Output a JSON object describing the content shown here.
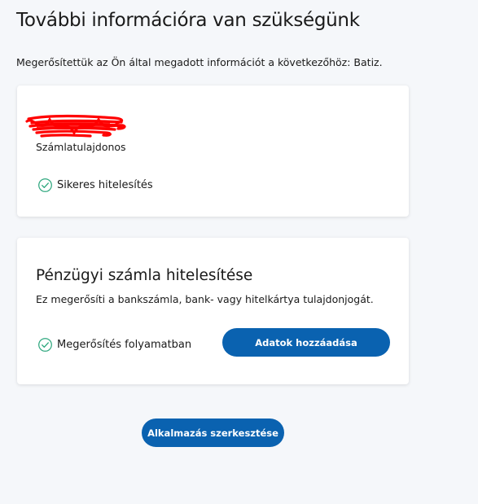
{
  "header": {
    "title": "További információra van szükségünk",
    "intro": "Megerősítettük az Ön által megadott információt a következőhöz: Batiz."
  },
  "account_card": {
    "role": "Számlatulajdonos",
    "status": "Sikeres hitelesítés",
    "status_icon": "check-circle-icon"
  },
  "verification_card": {
    "title": "Pénzügyi számla hitelesítése",
    "description": "Ez megerősíti a bankszámla, bank- vagy hitelkártya tulajdonjogát.",
    "status": "Megerősítés folyamatban",
    "status_icon": "check-circle-icon",
    "add_button_label": "Adatok hozzáadása"
  },
  "footer": {
    "edit_button_label": "Alkalmazás szerkesztése"
  },
  "colors": {
    "primary": "#0a62b0",
    "success": "#2ea77e",
    "redaction": "#ff0000",
    "background": "#f5f7fa"
  }
}
